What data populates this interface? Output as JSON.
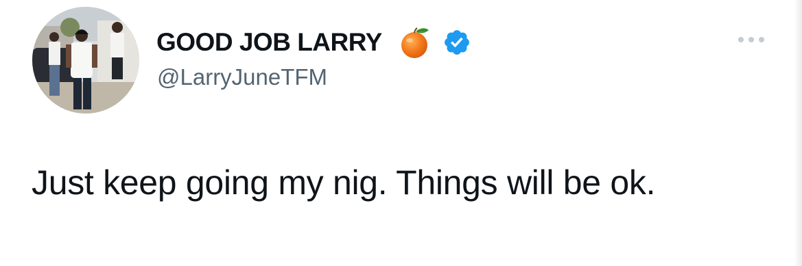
{
  "author": {
    "display_name": "GOOD JOB LARRY",
    "handle": "@LarryJuneTFM",
    "emoji_icon": "orange-emoji-icon",
    "verified_icon": "verified-badge-icon",
    "verified_color": "#1d9bf0"
  },
  "tweet": {
    "text": "Just keep going my nig. Things will be ok."
  },
  "menu": {
    "icon": "more-options-icon"
  },
  "colors": {
    "name_text": "#0f1419",
    "handle_text": "#536471",
    "more_icon": "#c5cbd0"
  }
}
